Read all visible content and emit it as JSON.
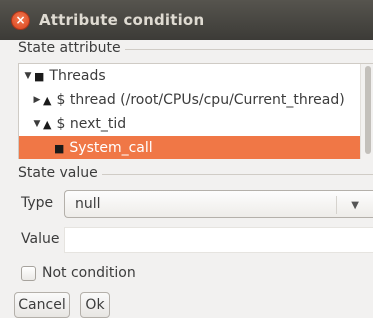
{
  "window": {
    "title": "Attribute condition",
    "close_glyph": "×"
  },
  "state_attribute": {
    "label": "State attribute",
    "tree": [
      {
        "expander": "▼",
        "glyph": "■",
        "label": "Threads",
        "selected": false
      },
      {
        "expander": "▶",
        "glyph": "▲",
        "label": "$ thread (/root/CPUs/cpu/Current_thread)",
        "selected": false
      },
      {
        "expander": "▼",
        "glyph": "▲",
        "label": "$ next_tid",
        "selected": false
      },
      {
        "expander": "",
        "glyph": "■",
        "label": "System_call",
        "selected": true
      }
    ]
  },
  "state_value": {
    "label": "State value",
    "type_label": "Type",
    "type_value": "null",
    "value_label": "Value",
    "value_text": ""
  },
  "not_condition": {
    "label": "Not condition",
    "checked": false
  },
  "buttons": {
    "cancel": "Cancel",
    "ok": "Ok"
  },
  "colors": {
    "selection": "#f07746",
    "titlebar": "#3c3b37",
    "close": "#e95420"
  }
}
